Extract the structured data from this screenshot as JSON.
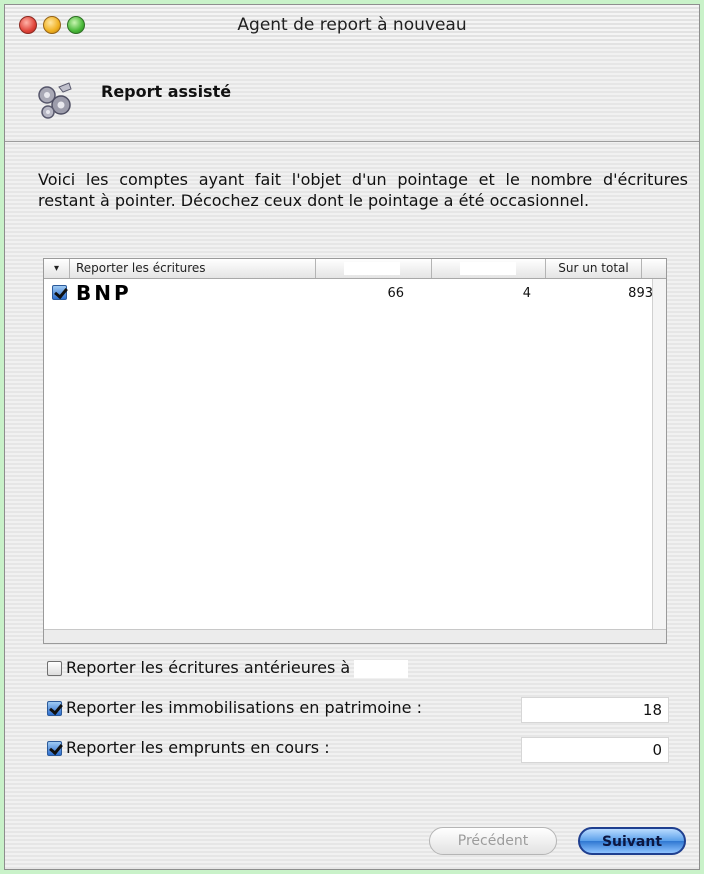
{
  "window": {
    "title": "Agent de report à nouveau"
  },
  "header": {
    "title": "Report assisté",
    "icon": "wizard-gears-icon"
  },
  "description": "Voici les comptes ayant fait l'objet d'un pointage et le nombre d'écritures restant à pointer. Décochez ceux dont le pointage a été occasionnel.",
  "table": {
    "sort_indicator": "▾",
    "columns": [
      "Reporter les écritures",
      "",
      "",
      "Sur un total"
    ],
    "rows": [
      {
        "checked": true,
        "name": "BNP",
        "col2": "66",
        "col3": "4",
        "total": "893"
      }
    ]
  },
  "options": {
    "anterior": {
      "label": "Reporter les écritures antérieures à",
      "checked": false
    },
    "immobilisations": {
      "label": "Reporter les immobilisations en patrimoine :",
      "checked": true,
      "value": "18"
    },
    "emprunts": {
      "label": "Reporter les emprunts en cours :",
      "checked": true,
      "value": "0"
    }
  },
  "buttons": {
    "previous": "Précédent",
    "next": "Suivant"
  },
  "colors": {
    "background": "#c9f2c9",
    "accent": "#2f78d2"
  }
}
